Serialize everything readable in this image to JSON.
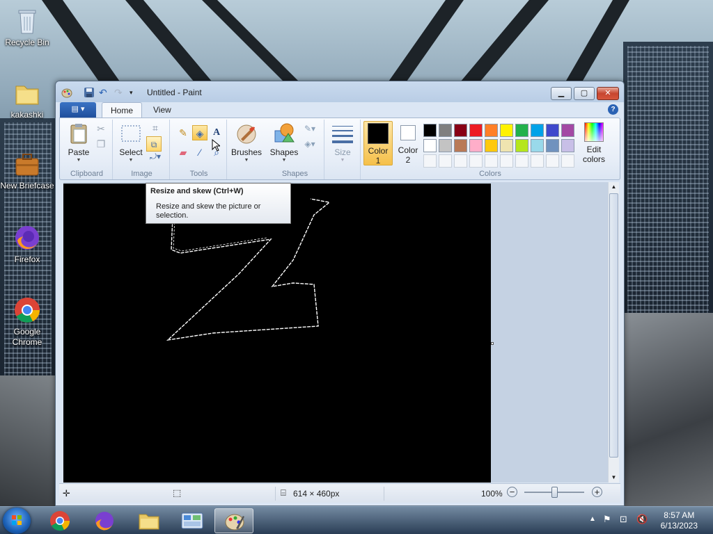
{
  "desktop": {
    "icons": [
      {
        "label": "Recycle Bin",
        "icon": "recycle-bin-icon"
      },
      {
        "label": "kakashki",
        "icon": "folder-icon"
      },
      {
        "label": "New Briefcase",
        "icon": "briefcase-icon"
      },
      {
        "label": "Firefox",
        "icon": "firefox-icon"
      },
      {
        "label": "Google Chrome",
        "icon": "chrome-icon"
      }
    ]
  },
  "window": {
    "title": "Untitled - Paint",
    "controls": {
      "minimize": "▁",
      "maximize": "▢",
      "close": "✕"
    },
    "help": "?"
  },
  "tabs": {
    "file": "▤ ▾",
    "home": "Home",
    "view": "View"
  },
  "ribbon": {
    "clipboard": {
      "label": "Clipboard",
      "paste": "Paste"
    },
    "image": {
      "label": "Image",
      "select": "Select"
    },
    "tools": {
      "label": "Tools"
    },
    "brushes": {
      "label": "Brushes"
    },
    "shapes": {
      "label": "Shapes",
      "button": "Shapes"
    },
    "size": {
      "label": "Size"
    },
    "colors": {
      "label": "Colors",
      "color1": "Color\n1",
      "color2": "Color\n2",
      "edit": "Edit\ncolors",
      "color1_value": "#000000",
      "color2_value": "#ffffff",
      "palette_row1": [
        "#000000",
        "#7f7f7f",
        "#880015",
        "#ed1c24",
        "#ff7f27",
        "#fff200",
        "#22b14c",
        "#00a2e8",
        "#3f48cc",
        "#a349a4"
      ],
      "palette_row2": [
        "#ffffff",
        "#c3c3c3",
        "#b97a57",
        "#ffaec9",
        "#ffc90e",
        "#efe4b0",
        "#b5e61d",
        "#99d9ea",
        "#7092be",
        "#c8bfe7"
      ]
    }
  },
  "tooltip": {
    "title": "Resize and skew (Ctrl+W)",
    "body": "Resize and skew the picture or selection."
  },
  "status": {
    "canvas_size": "614 × 460px",
    "zoom": "100%",
    "zoom_level": 100
  },
  "taskbar": {
    "items": [
      "chrome-icon",
      "firefox-icon",
      "explorer-icon",
      "control-panel-icon",
      "paint-icon"
    ],
    "time": "8:57 AM",
    "date": "6/13/2023"
  }
}
